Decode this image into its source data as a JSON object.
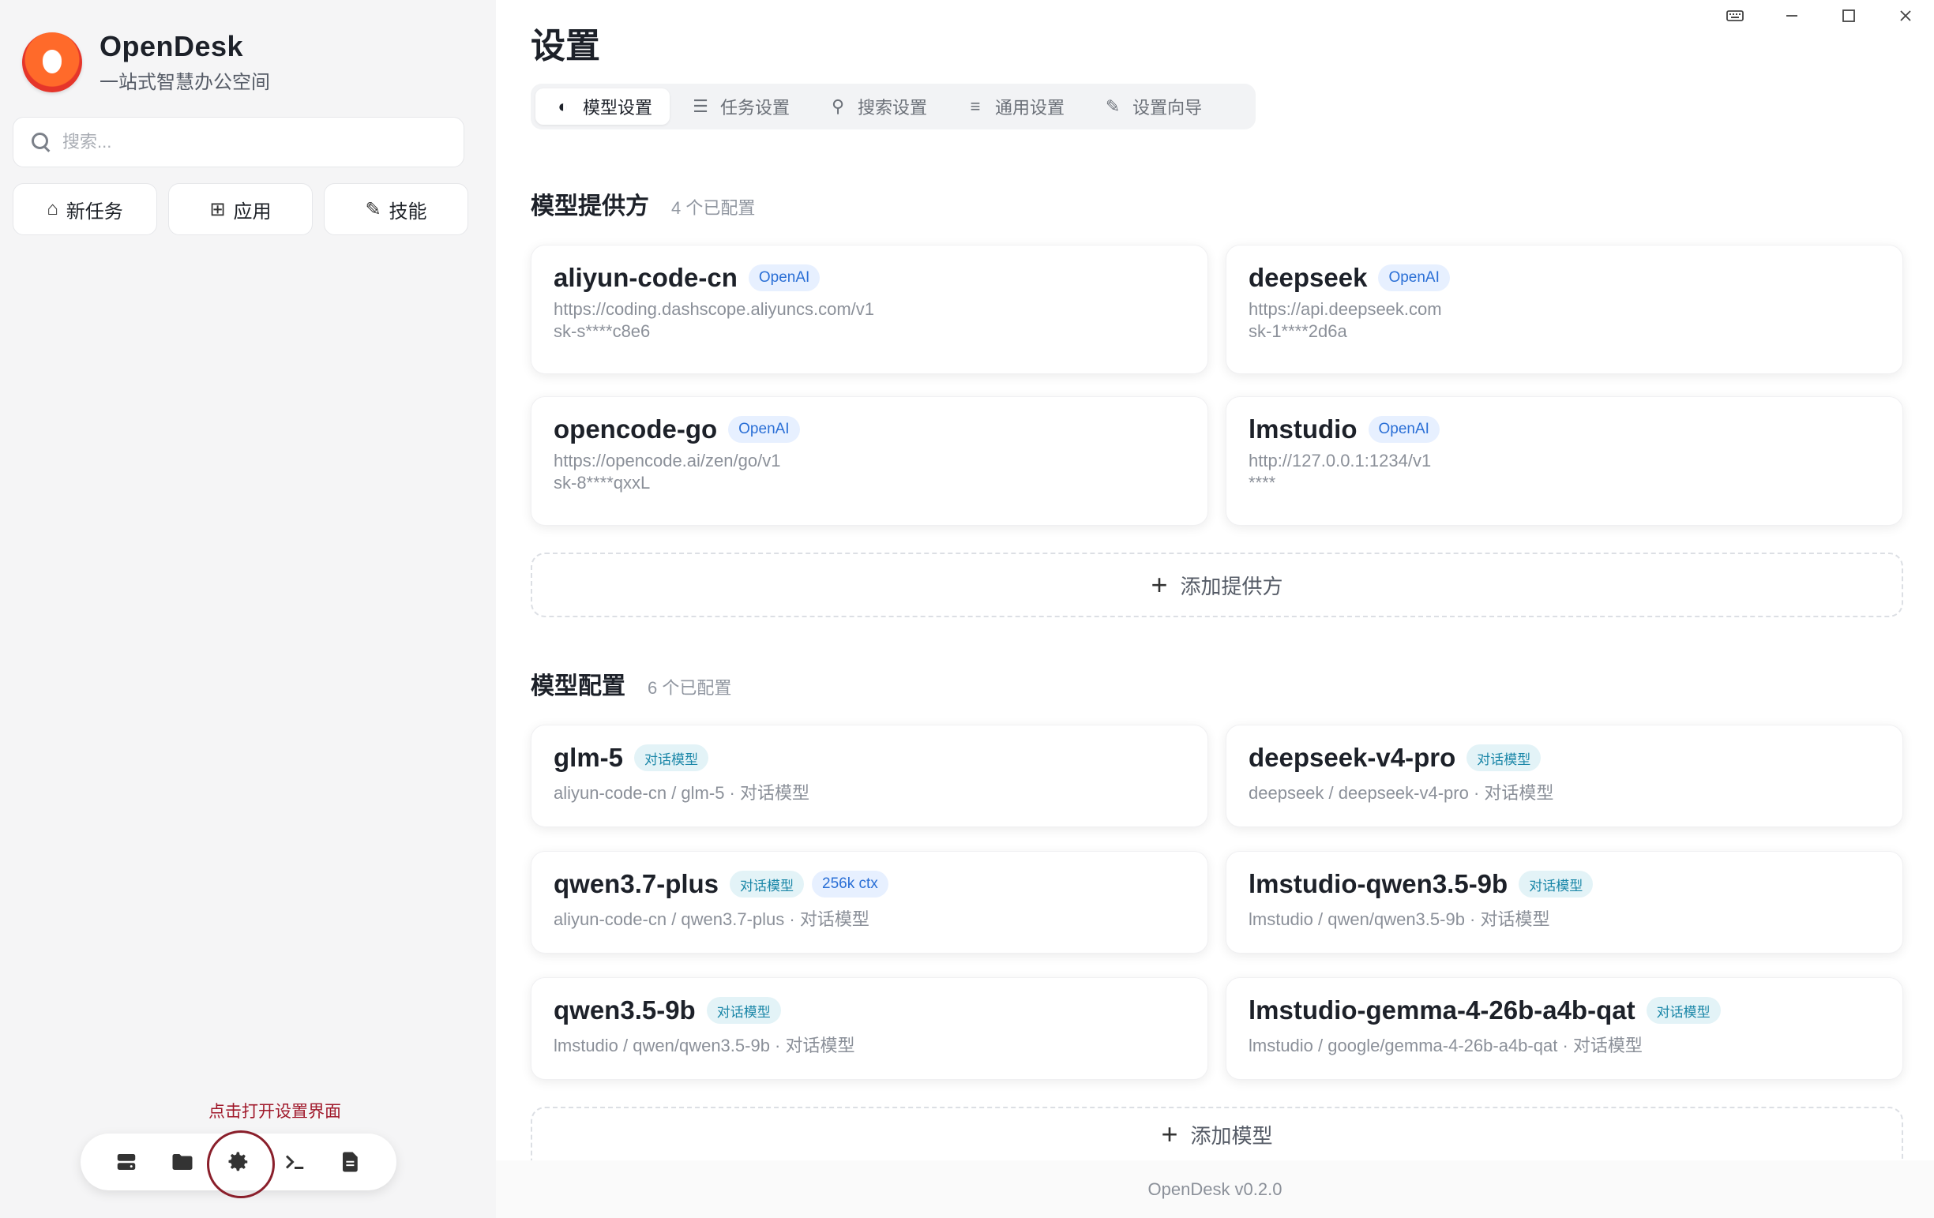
{
  "app": {
    "name": "OpenDesk",
    "subtitle": "一站式智慧办公空间",
    "version": "OpenDesk v0.2.0"
  },
  "sidebar": {
    "search_placeholder": "搜索...",
    "quick_actions": [
      {
        "label": "新任务",
        "icon": "home-icon"
      },
      {
        "label": "应用",
        "icon": "apps-grid-icon"
      },
      {
        "label": "技能",
        "icon": "magic-wand-icon"
      }
    ],
    "hint": "点击打开设置界面",
    "dock": [
      {
        "icon": "server-icon"
      },
      {
        "icon": "folder-icon"
      },
      {
        "icon": "gear-icon",
        "highlighted": true
      },
      {
        "icon": "terminal-icon"
      },
      {
        "icon": "document-icon"
      }
    ]
  },
  "settings": {
    "title": "设置",
    "tabs": [
      {
        "label": "模型设置",
        "icon": "brain-icon",
        "active": true
      },
      {
        "label": "任务设置",
        "icon": "list-icon",
        "active": false
      },
      {
        "label": "搜索设置",
        "icon": "search-icon",
        "active": false
      },
      {
        "label": "通用设置",
        "icon": "sliders-icon",
        "active": false
      },
      {
        "label": "设置向导",
        "icon": "pencil-icon",
        "active": false
      }
    ],
    "providers": {
      "title": "模型提供方",
      "count": "4 个已配置",
      "items": [
        {
          "name": "aliyun-code-cn",
          "badge": "OpenAI",
          "url": "https://coding.dashscope.aliyuncs.com/v1",
          "key": "sk-s****c8e6"
        },
        {
          "name": "deepseek",
          "badge": "OpenAI",
          "url": "https://api.deepseek.com",
          "key": "sk-1****2d6a"
        },
        {
          "name": "opencode-go",
          "badge": "OpenAI",
          "url": "https://opencode.ai/zen/go/v1",
          "key": "sk-8****qxxL"
        },
        {
          "name": "lmstudio",
          "badge": "OpenAI",
          "url": "http://127.0.0.1:1234/v1",
          "key": "****"
        }
      ],
      "add_label": "添加提供方"
    },
    "models": {
      "title": "模型配置",
      "count": "6 个已配置",
      "items": [
        {
          "name": "glm-5",
          "badges": [
            "对话模型"
          ],
          "detail": "aliyun-code-cn / glm-5 · 对话模型"
        },
        {
          "name": "deepseek-v4-pro",
          "badges": [
            "对话模型"
          ],
          "detail": "deepseek / deepseek-v4-pro · 对话模型"
        },
        {
          "name": "qwen3.7-plus",
          "badges": [
            "对话模型",
            "256k ctx"
          ],
          "detail": "aliyun-code-cn / qwen3.7-plus · 对话模型"
        },
        {
          "name": "lmstudio-qwen3.5-9b",
          "badges": [
            "对话模型"
          ],
          "detail": "lmstudio / qwen/qwen3.5-9b · 对话模型"
        },
        {
          "name": "qwen3.5-9b",
          "badges": [
            "对话模型"
          ],
          "detail": "lmstudio / qwen/qwen3.5-9b · 对话模型"
        },
        {
          "name": "lmstudio-gemma-4-26b-a4b-qat",
          "badges": [
            "对话模型"
          ],
          "detail": "lmstudio / google/gemma-4-26b-a4b-qat · 对话模型"
        }
      ],
      "add_label": "添加模型"
    }
  },
  "colors": {
    "accent": "#2a6fd6",
    "hint": "#a0182a",
    "highlight_ring": "#8a1f2b"
  }
}
